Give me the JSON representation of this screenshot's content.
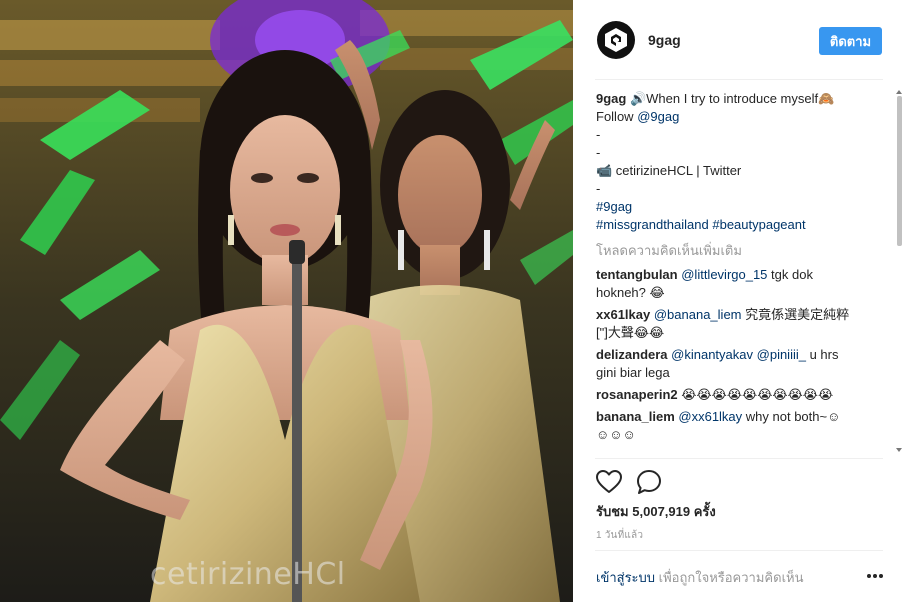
{
  "post": {
    "username": "9gag",
    "follow_label": "ติดตาม",
    "caption": {
      "user": "9gag",
      "lines": [
        "🔊When I try to introduce myself🙈",
        "Follow ",
        "-",
        "-",
        "📹 cetirizineHCL | Twitter",
        "-"
      ],
      "follow_mention": "@9gag",
      "hashtag_line1": "#9gag",
      "hashtag_line2a": "#missgrandthailand",
      "hashtag_line2b": "#beautypageant"
    },
    "load_more": "โหลดความคิดเห็นเพิ่มเติม",
    "comments": [
      {
        "user": "tentangbulan",
        "mention": "@littlevirgo_15",
        "text": " tgk dok",
        "text2": "hokneh? 😂"
      },
      {
        "user": "xx61lkay",
        "mention": "@banana_liem",
        "text": " 究竟係選美定純粹",
        "text2": "[\"]大聲😂😂"
      },
      {
        "user": "delizandera",
        "mention": "@kinantyakav",
        "mention2": "@piniiii_",
        "text": " u hrs",
        "text2": "gini biar lega"
      },
      {
        "user": "rosanaperin2",
        "text": " 😭😭😭😭😭😭😭😭😭😭"
      },
      {
        "user": "banana_liem",
        "mention": "@xx61lkay",
        "text": " why not both~☺",
        "text2": "☺☺☺"
      }
    ],
    "views_label": "รับชม",
    "views_count": "5,007,919",
    "views_unit": "ครั้ง",
    "time_ago": "1 วันที่แล้ว",
    "login_link": "เข้าสู่ระบบ",
    "login_rest": "เพื่อถูกใจหรือความคิดเห็น",
    "watermark": "cetirizineHCl"
  },
  "colors": {
    "follow_button": "#3897f0",
    "link": "#003569",
    "muted": "#999999"
  },
  "icons": {
    "avatar": "9gag-logo-icon",
    "like": "heart-icon",
    "comment": "speech-bubble-icon",
    "more": "ellipsis-icon"
  }
}
